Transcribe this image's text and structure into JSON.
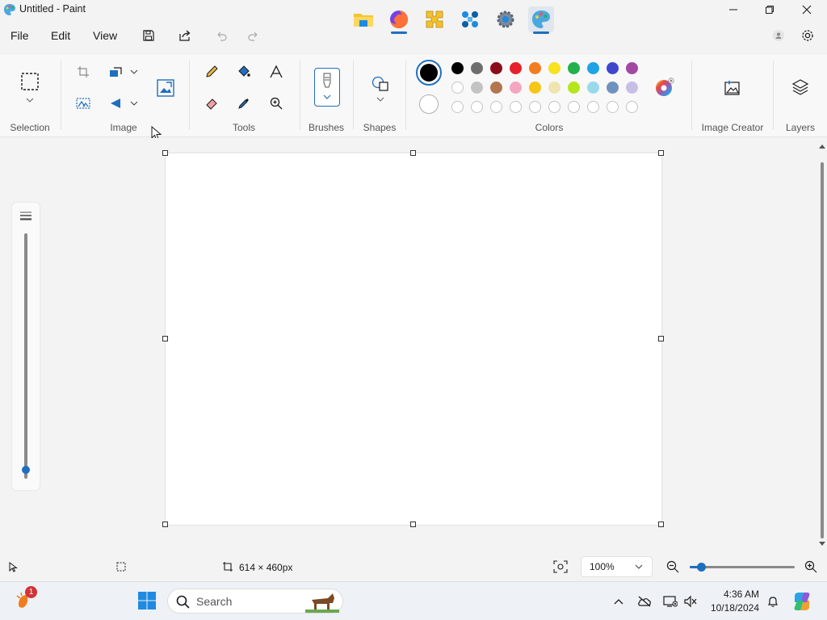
{
  "window": {
    "title": "Untitled - Paint"
  },
  "menu": {
    "file": "File",
    "edit": "Edit",
    "view": "View"
  },
  "ribbon": {
    "groups": {
      "selection": "Selection",
      "image": "Image",
      "tools": "Tools",
      "brushes": "Brushes",
      "shapes": "Shapes",
      "colors": "Colors",
      "image_creator": "Image Creator",
      "layers": "Layers"
    },
    "colors": {
      "primary": "#000000",
      "secondary": "#ffffff",
      "row1": [
        "#000000",
        "#6e6e6e",
        "#8b0d1a",
        "#e8202a",
        "#f47c20",
        "#f7e21c",
        "#22b14c",
        "#1fa3e4",
        "#3f48cc",
        "#a349a4"
      ],
      "row2": [
        "#ffffff",
        "#c3c3c3",
        "#b5754f",
        "#f4a6c1",
        "#f7c514",
        "#efe4b0",
        "#b5e61d",
        "#99d9ea",
        "#7092be",
        "#c8bfe7"
      ],
      "row3_count": 10
    }
  },
  "status": {
    "canvas_size": "614 × 460px",
    "zoom": "100%",
    "zoom_level": 0.11
  },
  "brush_size": {
    "level": 0.02
  },
  "taskbar": {
    "search_placeholder": "Search",
    "notification_count": "1",
    "time": "4:36 AM",
    "date": "10/18/2024"
  }
}
